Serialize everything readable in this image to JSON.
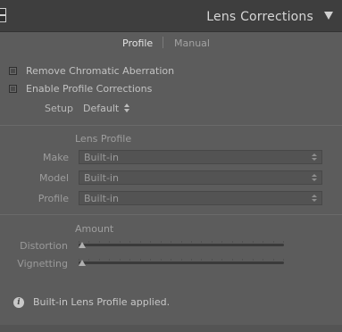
{
  "header": {
    "title": "Lens Corrections",
    "collapse_icon": "triangle-down-icon"
  },
  "tabs": {
    "profile": "Profile",
    "manual": "Manual",
    "active": "Profile"
  },
  "checkboxes": [
    {
      "label": "Remove Chromatic Aberration",
      "checked": false
    },
    {
      "label": "Enable Profile Corrections",
      "checked": false
    }
  ],
  "setup": {
    "label": "Setup",
    "value": "Default"
  },
  "lens_profile": {
    "title": "Lens Profile",
    "make": {
      "label": "Make",
      "value": "Built-in"
    },
    "model": {
      "label": "Model",
      "value": "Built-in"
    },
    "profile": {
      "label": "Profile",
      "value": "Built-in"
    }
  },
  "amount": {
    "title": "Amount",
    "distortion": {
      "label": "Distortion",
      "value": 0
    },
    "vignetting": {
      "label": "Vignetting",
      "value": 0
    }
  },
  "info": {
    "icon": "info-icon",
    "message": "Built-in Lens Profile applied."
  }
}
